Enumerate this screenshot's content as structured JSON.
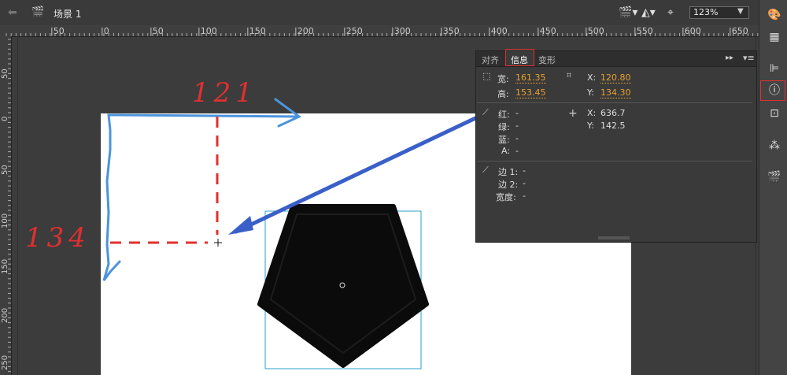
{
  "topbar": {
    "back_icon": "back-arrow-icon",
    "scene_icon": "clapper-icon",
    "scene_label": "场景 1",
    "zoom": "123%"
  },
  "ruler": {
    "h_ticks": [
      "|50",
      "|0",
      "|50",
      "|100",
      "|150",
      "|200",
      "|250",
      "|300",
      "|350",
      "|400",
      "|450",
      "|500",
      "|550",
      "|600",
      "|650"
    ],
    "v_ticks": [
      "50",
      "0",
      "50",
      "100",
      "150",
      "200",
      "250"
    ]
  },
  "panel": {
    "tabs": [
      "对齐",
      "信息",
      "变形"
    ],
    "width_label": "宽:",
    "width_value": "161.35",
    "height_label": "高:",
    "height_value": "153.45",
    "x_label": "X:",
    "x_value": "120.80",
    "y_label": "Y:",
    "y_value": "134.30",
    "red_label": "红:",
    "green_label": "绿:",
    "blue_label": "蓝:",
    "alpha_label": "A:",
    "dash": "-",
    "mouse_x_label": "X:",
    "mouse_x_value": "636.7",
    "mouse_y_label": "Y:",
    "mouse_y_value": "142.5",
    "edge1_label": "边 1:",
    "edge2_label": "边 2:",
    "stroke_width_label": "宽度:"
  },
  "annotations": {
    "x_value": "121",
    "y_value": "134",
    "note_color": "#e03030",
    "arrow_color": "#3a6fd8"
  },
  "colors": {
    "accent_orange": "#e8a030",
    "highlight_red": "#e03030"
  }
}
